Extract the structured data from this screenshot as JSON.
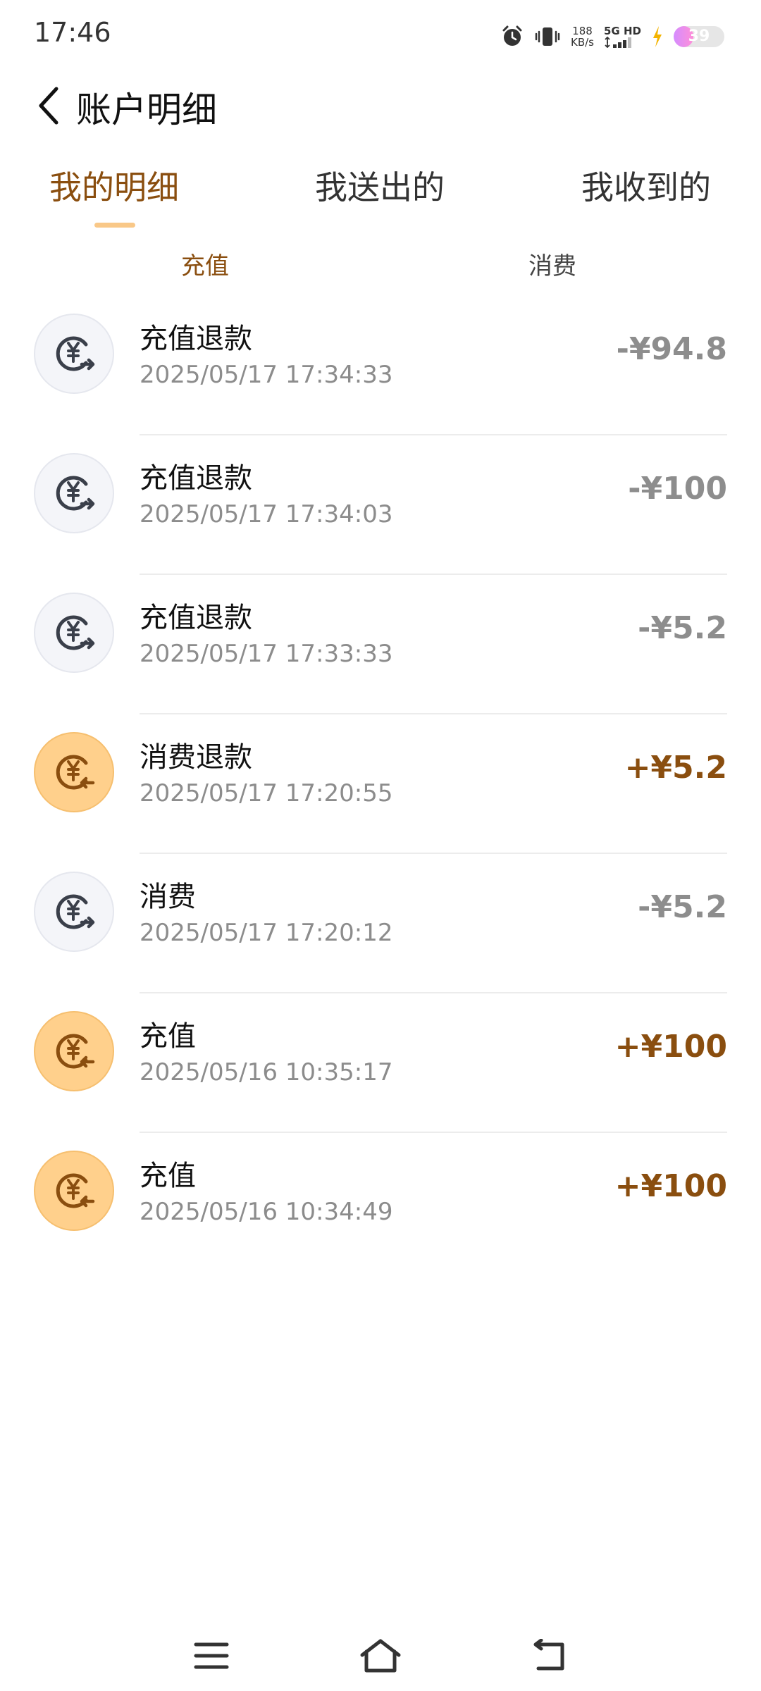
{
  "status_bar": {
    "time": "17:46",
    "net_speed_value": "188",
    "net_speed_unit": "KB/s",
    "network_type": "5G",
    "hd_label": "HD",
    "battery_level": "39",
    "icons": [
      "alarm-icon",
      "vibrate-icon",
      "signal-icon",
      "charging-icon",
      "battery-icon"
    ]
  },
  "header": {
    "title": "账户明细"
  },
  "tabs": [
    {
      "label": "我的明细",
      "active": true
    },
    {
      "label": "我送出的",
      "active": false
    },
    {
      "label": "我收到的",
      "active": false
    }
  ],
  "subtabs": [
    {
      "label": "充值",
      "active": true
    },
    {
      "label": "消费",
      "active": false
    }
  ],
  "colors": {
    "accent": "#8a4e0f",
    "accent_light": "#ffd08c",
    "indicator": "#f9c888",
    "muted_amount": "#8d8d8d",
    "time_text": "#8c8c8c"
  },
  "transactions": [
    {
      "title": "充值退款",
      "time": "2025/05/17 17:34:33",
      "amount": "-¥94.8",
      "direction": "out"
    },
    {
      "title": "充值退款",
      "time": "2025/05/17 17:34:03",
      "amount": "-¥100",
      "direction": "out"
    },
    {
      "title": "充值退款",
      "time": "2025/05/17 17:33:33",
      "amount": "-¥5.2",
      "direction": "out"
    },
    {
      "title": "消费退款",
      "time": "2025/05/17 17:20:55",
      "amount": "+¥5.2",
      "direction": "in"
    },
    {
      "title": "消费",
      "time": "2025/05/17 17:20:12",
      "amount": "-¥5.2",
      "direction": "out"
    },
    {
      "title": "充值",
      "time": "2025/05/16 10:35:17",
      "amount": "+¥100",
      "direction": "in"
    },
    {
      "title": "充值",
      "time": "2025/05/16 10:34:49",
      "amount": "+¥100",
      "direction": "in"
    }
  ],
  "nav_bar": {
    "buttons": [
      "menu-icon",
      "home-icon",
      "back-icon"
    ]
  }
}
